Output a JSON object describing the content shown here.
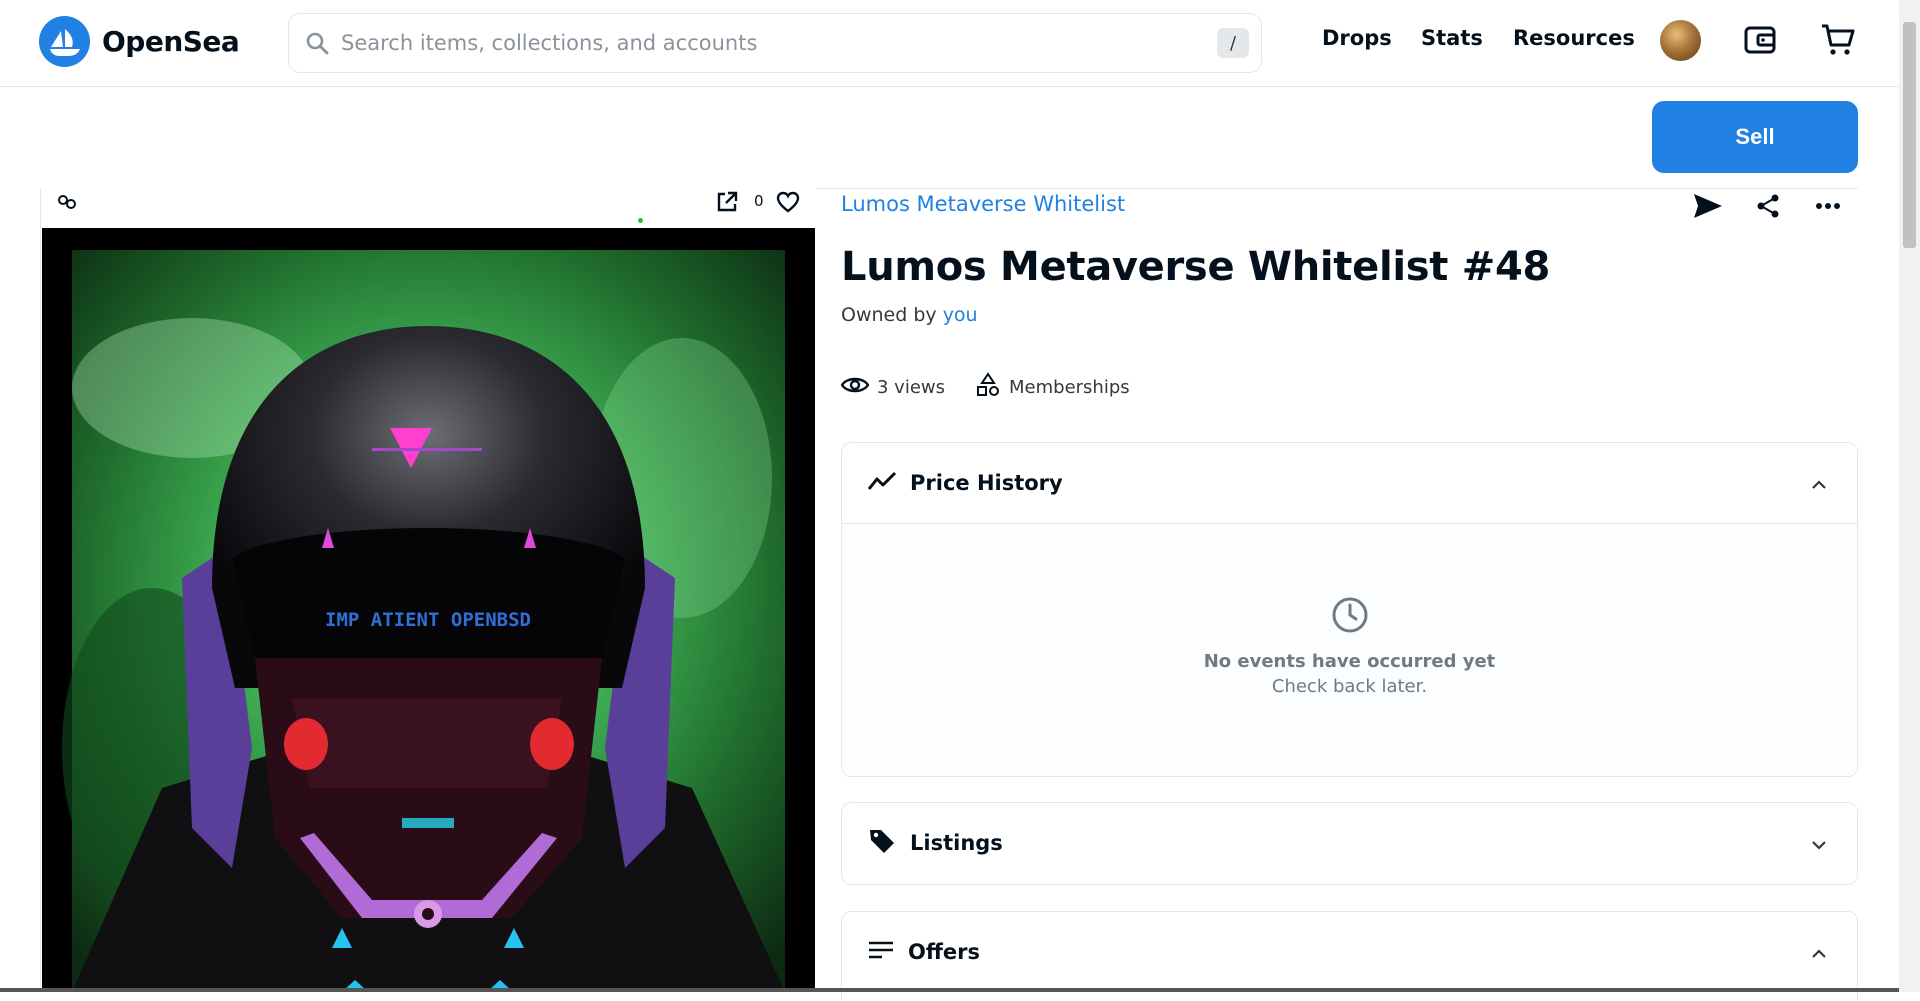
{
  "header": {
    "brand": "OpenSea",
    "search_placeholder": "Search items, collections, and accounts",
    "search_shortcut": "/",
    "nav": [
      "Drops",
      "Stats",
      "Resources"
    ]
  },
  "actions": {
    "sell_label": "Sell"
  },
  "media": {
    "favorite_count": "0",
    "image_text": "IMP ATIENT OPENBSD"
  },
  "item": {
    "collection": "Lumos Metaverse Whitelist",
    "title": "Lumos Metaverse Whitelist #48",
    "owned_by_prefix": "Owned by",
    "owner": "you",
    "views": "3 views",
    "category": "Memberships"
  },
  "panels": {
    "price_history": {
      "title": "Price History",
      "empty_title": "No events have occurred yet",
      "empty_sub": "Check back later."
    },
    "listings": {
      "title": "Listings"
    },
    "offers": {
      "title": "Offers"
    }
  },
  "colors": {
    "accent": "#2081e2",
    "text": "#04111d",
    "border": "#e5e8eb"
  }
}
